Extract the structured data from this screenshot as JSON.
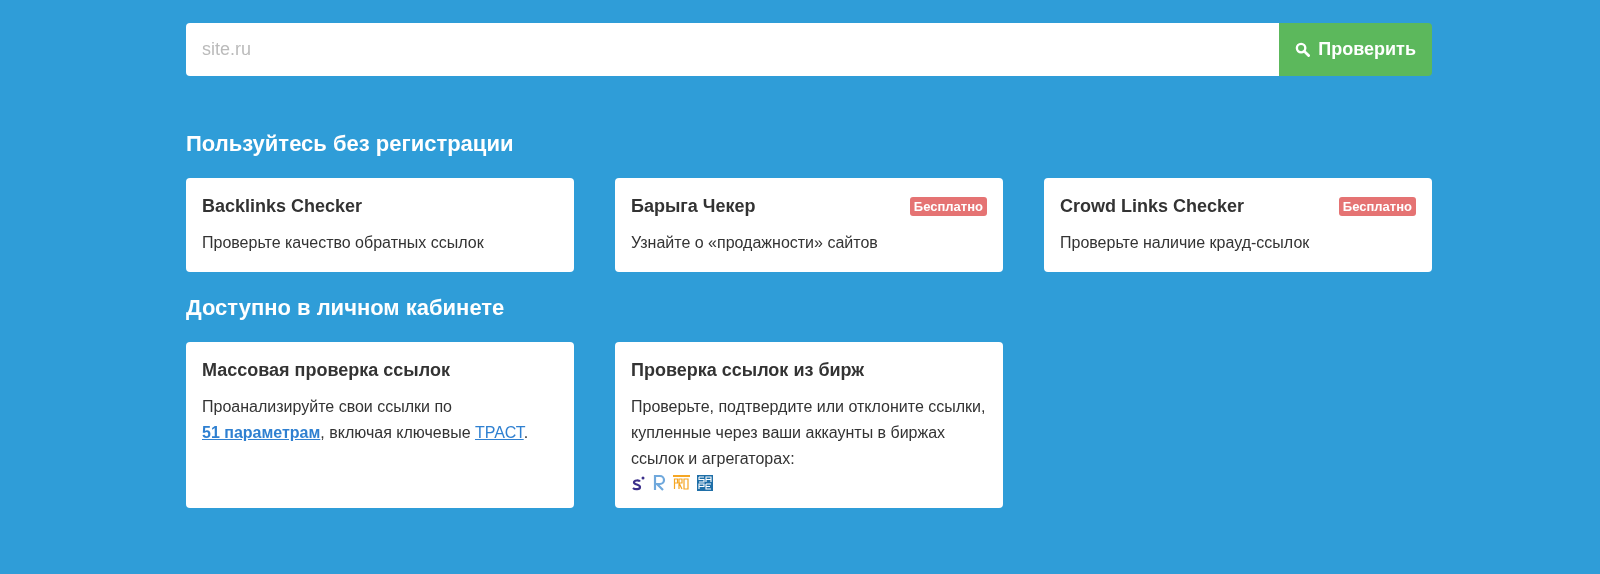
{
  "search": {
    "placeholder": "site.ru",
    "button": "Проверить"
  },
  "sections": [
    {
      "title": "Пользуйтесь без регистрации",
      "cards": [
        {
          "title": "Backlinks Checker",
          "parts": [
            {
              "kind": "text",
              "text": "Проверьте качество обратных ссылок"
            }
          ]
        },
        {
          "title": "Барыга Чекер",
          "badge": "Бесплатно",
          "parts": [
            {
              "kind": "text",
              "text": "Узнайте о «продажности» сайтов"
            }
          ]
        },
        {
          "title": "Crowd Links Checker",
          "badge": "Бесплатно",
          "parts": [
            {
              "kind": "text",
              "text": "Проверьте наличие крауд-ссылок"
            }
          ]
        }
      ]
    },
    {
      "title": "Доступно в личном кабинете",
      "cards": [
        {
          "title": "Массовая проверка ссылок",
          "parts": [
            {
              "kind": "text",
              "text": "Проанализируйте свои ссылки по "
            },
            {
              "kind": "link",
              "text": "51 параметрам",
              "bold": true
            },
            {
              "kind": "text",
              "text": ", включая ключевые "
            },
            {
              "kind": "link",
              "text": "ТРАСТ",
              "bold": false
            },
            {
              "kind": "text",
              "text": "."
            }
          ]
        },
        {
          "title": "Проверка ссылок из бирж",
          "parts": [
            {
              "kind": "text",
              "text": "Проверьте, подтвердите или отклоните ссылки, купленные через ваши аккаунты в биржах ссылок и агрегаторах:"
            }
          ],
          "logos": [
            {
              "kind": "s"
            },
            {
              "kind": "r"
            },
            {
              "kind": "pro"
            },
            {
              "kind": "sape"
            }
          ]
        }
      ]
    }
  ]
}
